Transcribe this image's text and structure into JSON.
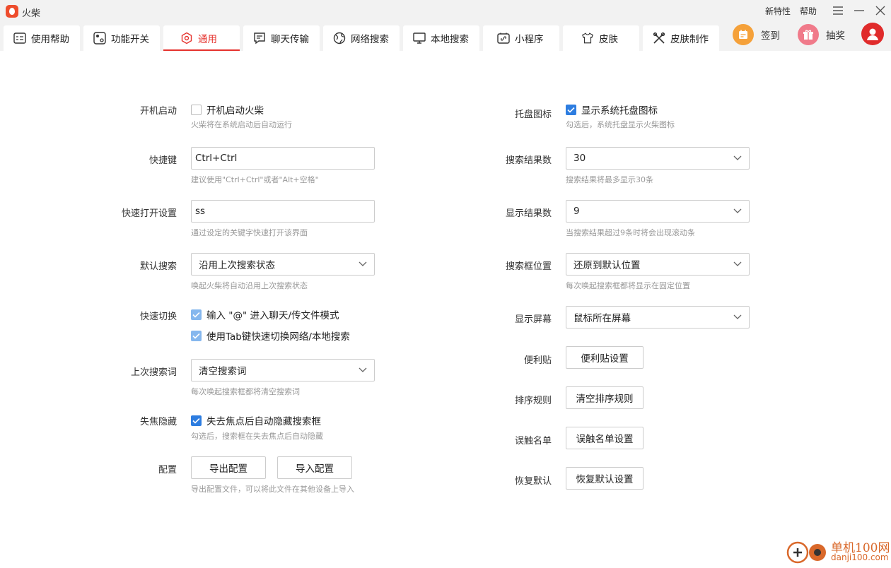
{
  "window": {
    "title": "火柴",
    "links": {
      "whats_new": "新特性",
      "help": "帮助"
    }
  },
  "tabs": [
    {
      "label": "使用帮助",
      "icon": "help-doc-icon"
    },
    {
      "label": "功能开关",
      "icon": "toggle-icon"
    },
    {
      "label": "通用",
      "icon": "hexagon-settings-icon",
      "active": true
    },
    {
      "label": "聊天传输",
      "icon": "chat-transfer-icon"
    },
    {
      "label": "网络搜索",
      "icon": "globe-icon"
    },
    {
      "label": "本地搜索",
      "icon": "monitor-icon"
    },
    {
      "label": "小程序",
      "icon": "mini-program-icon"
    },
    {
      "label": "皮肤",
      "icon": "tshirt-icon"
    },
    {
      "label": "皮肤制作",
      "icon": "tools-icon"
    }
  ],
  "actions": {
    "checkin": "签到",
    "lottery": "抽奖"
  },
  "left": {
    "startup": {
      "label": "开机启动",
      "checkbox": "开机启动火柴",
      "checked": false,
      "hint": "火柴将在系统启动后自动运行"
    },
    "hotkey": {
      "label": "快捷键",
      "value": "Ctrl+Ctrl",
      "hint": "建议使用\"Ctrl+Ctrl\"或者\"Alt+空格\""
    },
    "quick_open": {
      "label": "快速打开设置",
      "value": "ss",
      "hint": "通过设定的关键字快速打开该界面"
    },
    "default_search": {
      "label": "默认搜索",
      "value": "沿用上次搜索状态",
      "hint": "唤起火柴将自动沿用上次搜索状态"
    },
    "quick_switch": {
      "label": "快速切换",
      "option1": "输入 \"@\" 进入聊天/传文件模式",
      "option2": "使用Tab键快速切换网络/本地搜索"
    },
    "last_query": {
      "label": "上次搜索词",
      "value": "清空搜索词",
      "hint": "每次唤起搜索框都将清空搜索词"
    },
    "blur_hide": {
      "label": "失焦隐藏",
      "checkbox": "失去焦点后自动隐藏搜索框",
      "checked": true,
      "hint": "勾选后，搜索框在失去焦点后自动隐藏"
    },
    "config": {
      "label": "配置",
      "export": "导出配置",
      "import": "导入配置",
      "hint": "导出配置文件，可以将此文件在其他设备上导入"
    }
  },
  "right": {
    "tray": {
      "label": "托盘图标",
      "checkbox": "显示系统托盘图标",
      "checked": true,
      "hint": "勾选后，系统托盘显示火柴图标"
    },
    "result_count": {
      "label": "搜索结果数",
      "value": "30",
      "hint": "搜索结果将最多显示30条"
    },
    "display_count": {
      "label": "显示结果数",
      "value": "9",
      "hint": "当搜索结果超过9条时将会出现滚动条"
    },
    "box_position": {
      "label": "搜索框位置",
      "value": "还原到默认位置",
      "hint": "每次唤起搜索框都将显示在固定位置"
    },
    "screen": {
      "label": "显示屏幕",
      "value": "鼠标所在屏幕"
    },
    "sticky": {
      "label": "便利贴",
      "button": "便利贴设置"
    },
    "sort": {
      "label": "排序规则",
      "button": "清空排序规则"
    },
    "mistouch": {
      "label": "误触名单",
      "button": "误触名单设置"
    },
    "restore": {
      "label": "恢复默认",
      "button": "恢复默认设置"
    }
  },
  "watermark": {
    "text": "单机100网",
    "sub": "danji100.com"
  },
  "colors": {
    "accent": "#e5322d",
    "checkbox": "#2d7de0",
    "hint": "#999999"
  }
}
